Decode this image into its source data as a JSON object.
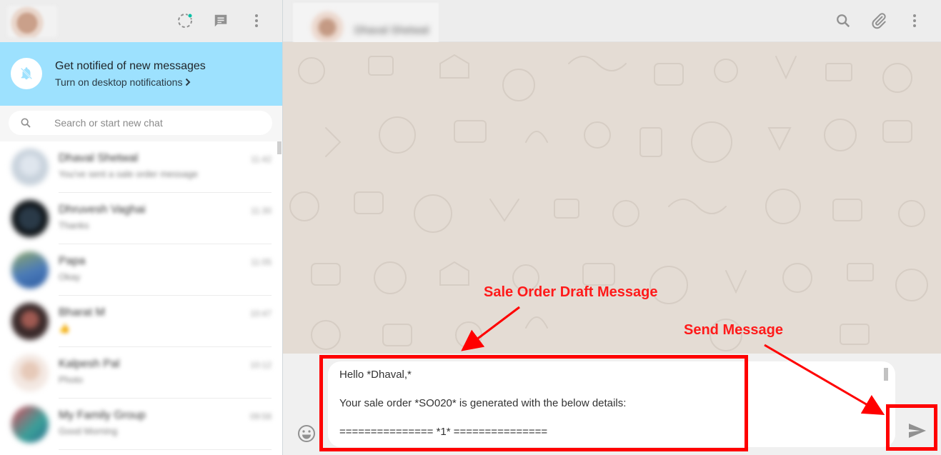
{
  "notification": {
    "title": "Get notified of new messages",
    "subtitle": "Turn on desktop notifications"
  },
  "search": {
    "placeholder": "Search or start new chat"
  },
  "chats": [
    {
      "name": "Dhaval Shetwal",
      "preview": "You've sent a sale order message",
      "time": "11:42"
    },
    {
      "name": "Dhruvesh Vaghai",
      "preview": "Thanks",
      "time": "11:30"
    },
    {
      "name": "Papa",
      "preview": "Okay",
      "time": "11:05"
    },
    {
      "name": "Bharat M",
      "preview": "👍",
      "time": "10:47"
    },
    {
      "name": "Kalpesh Pal",
      "preview": "Photo",
      "time": "10:12"
    },
    {
      "name": "My Family Group",
      "preview": "Good Morning",
      "time": "09:58"
    }
  ],
  "conversation": {
    "contact_name": "Dhaval Shetwal"
  },
  "compose": {
    "lines": [
      "Hello *Dhaval,*",
      "Your sale order *SO020* is generated with the below details:",
      "=============== *1* ==============="
    ]
  },
  "annotations": {
    "draft_label": "Sale Order Draft Message",
    "send_label": "Send Message"
  },
  "colors": {
    "notification_bg": "#9de1fe",
    "chat_bg": "#e4dcd4",
    "annotation_red": "#ff0000",
    "status_dot": "#00bfa5"
  },
  "icons": [
    "status-icon",
    "new-chat-icon",
    "menu-icon",
    "bell-off-icon",
    "chevron-right-icon",
    "search-icon",
    "attach-icon",
    "emoji-icon",
    "send-icon"
  ]
}
